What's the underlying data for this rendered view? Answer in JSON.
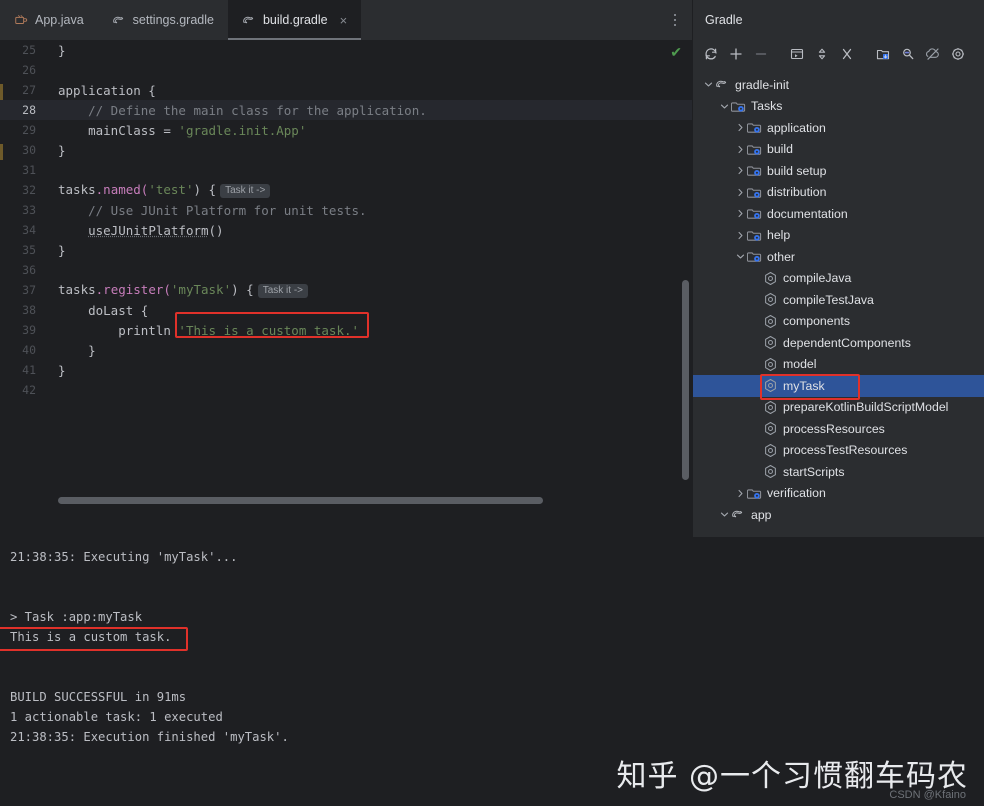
{
  "editor": {
    "tabs": [
      {
        "label": "App.java",
        "icon": "java-class-icon",
        "active": false,
        "closable": false
      },
      {
        "label": "settings.gradle",
        "icon": "gradle-elephant-icon",
        "active": false,
        "closable": false
      },
      {
        "label": "build.gradle",
        "icon": "gradle-elephant-icon",
        "active": true,
        "closable": true
      }
    ],
    "close_glyph": "×",
    "overflow_menu": "more-options",
    "inspection_status": "✔",
    "lines": [
      {
        "num": "25",
        "segments": [
          {
            "t": "}",
            "c": "plain"
          }
        ]
      },
      {
        "num": "26",
        "segments": []
      },
      {
        "num": "27",
        "segments": [
          {
            "t": "application {",
            "c": "plain"
          }
        ]
      },
      {
        "num": "28",
        "current": true,
        "segments": [
          {
            "t": "    // Define the main class for the application.",
            "c": "comment"
          }
        ]
      },
      {
        "num": "29",
        "segments": [
          {
            "t": "    mainClass = ",
            "c": "plain"
          },
          {
            "t": "'gradle.init.App'",
            "c": "string"
          }
        ]
      },
      {
        "num": "30",
        "segments": [
          {
            "t": "}",
            "c": "plain"
          }
        ]
      },
      {
        "num": "31",
        "segments": []
      },
      {
        "num": "32",
        "segments": [
          {
            "t": "tasks",
            "c": "plain"
          },
          {
            "t": ".named(",
            "c": "prop"
          },
          {
            "t": "'test'",
            "c": "string"
          },
          {
            "t": ") {",
            "c": "plain"
          },
          {
            "t": "Task it ->",
            "c": "inlay"
          }
        ]
      },
      {
        "num": "33",
        "segments": [
          {
            "t": "    // Use JUnit Platform for unit tests.",
            "c": "comment"
          }
        ]
      },
      {
        "num": "34",
        "segments": [
          {
            "t": "    ",
            "c": "plain"
          },
          {
            "t": "useJUnitPlatform",
            "c": "underline"
          },
          {
            "t": "()",
            "c": "plain"
          }
        ]
      },
      {
        "num": "35",
        "segments": [
          {
            "t": "}",
            "c": "plain"
          }
        ]
      },
      {
        "num": "36",
        "segments": []
      },
      {
        "num": "37",
        "segments": [
          {
            "t": "tasks",
            "c": "plain"
          },
          {
            "t": ".register(",
            "c": "prop"
          },
          {
            "t": "'myTask'",
            "c": "string"
          },
          {
            "t": ") {",
            "c": "plain"
          },
          {
            "t": "Task it ->",
            "c": "inlay"
          }
        ]
      },
      {
        "num": "38",
        "segments": [
          {
            "t": "    doLast {",
            "c": "plain"
          }
        ]
      },
      {
        "num": "39",
        "segments": [
          {
            "t": "        println ",
            "c": "plain"
          },
          {
            "t": "'This is a custom task.'",
            "c": "string"
          }
        ]
      },
      {
        "num": "40",
        "segments": [
          {
            "t": "    }",
            "c": "plain"
          }
        ]
      },
      {
        "num": "41",
        "segments": [
          {
            "t": "}",
            "c": "plain"
          }
        ]
      },
      {
        "num": "42",
        "segments": []
      }
    ]
  },
  "gradle": {
    "title": "Gradle",
    "toolbar": [
      {
        "name": "reload-all-gradle-projects-icon"
      },
      {
        "name": "link-gradle-project-icon"
      },
      {
        "name": "detach-gradle-project-icon"
      },
      {
        "name": "attach-gradle-project-icon"
      },
      {
        "name": "expand-collapse-icon"
      },
      {
        "name": "execute-task-icon"
      },
      {
        "name": "toggle-offline-mode-icon"
      },
      {
        "name": "show-dependencies-icon"
      },
      {
        "name": "skip-tests-icon"
      },
      {
        "name": "gradle-settings-icon"
      }
    ],
    "tree": [
      {
        "label": "gradle-init",
        "depth": 0,
        "twist": "expanded",
        "icon": "gradle-elephant-icon"
      },
      {
        "label": "Tasks",
        "depth": 1,
        "twist": "expanded",
        "icon": "task-folder-icon"
      },
      {
        "label": "application",
        "depth": 2,
        "twist": "collapsed",
        "icon": "task-folder-icon"
      },
      {
        "label": "build",
        "depth": 2,
        "twist": "collapsed",
        "icon": "task-folder-icon"
      },
      {
        "label": "build setup",
        "depth": 2,
        "twist": "collapsed",
        "icon": "task-folder-icon"
      },
      {
        "label": "distribution",
        "depth": 2,
        "twist": "collapsed",
        "icon": "task-folder-icon"
      },
      {
        "label": "documentation",
        "depth": 2,
        "twist": "collapsed",
        "icon": "task-folder-icon"
      },
      {
        "label": "help",
        "depth": 2,
        "twist": "collapsed",
        "icon": "task-folder-icon"
      },
      {
        "label": "other",
        "depth": 2,
        "twist": "expanded",
        "icon": "task-folder-icon"
      },
      {
        "label": "compileJava",
        "depth": 3,
        "twist": "none",
        "icon": "gradle-task-icon"
      },
      {
        "label": "compileTestJava",
        "depth": 3,
        "twist": "none",
        "icon": "gradle-task-icon"
      },
      {
        "label": "components",
        "depth": 3,
        "twist": "none",
        "icon": "gradle-task-icon"
      },
      {
        "label": "dependentComponents",
        "depth": 3,
        "twist": "none",
        "icon": "gradle-task-icon"
      },
      {
        "label": "model",
        "depth": 3,
        "twist": "none",
        "icon": "gradle-task-icon"
      },
      {
        "label": "myTask",
        "depth": 3,
        "twist": "none",
        "icon": "gradle-task-icon",
        "selected": true,
        "highlighted": true
      },
      {
        "label": "prepareKotlinBuildScriptModel",
        "depth": 3,
        "twist": "none",
        "icon": "gradle-task-icon"
      },
      {
        "label": "processResources",
        "depth": 3,
        "twist": "none",
        "icon": "gradle-task-icon"
      },
      {
        "label": "processTestResources",
        "depth": 3,
        "twist": "none",
        "icon": "gradle-task-icon"
      },
      {
        "label": "startScripts",
        "depth": 3,
        "twist": "none",
        "icon": "gradle-task-icon"
      },
      {
        "label": "verification",
        "depth": 2,
        "twist": "collapsed",
        "icon": "task-folder-icon"
      },
      {
        "label": "app",
        "depth": 1,
        "twist": "expanded",
        "icon": "gradle-elephant-icon"
      }
    ]
  },
  "console": {
    "lines": [
      "21:38:35: Executing 'myTask'...",
      "",
      "",
      "> Task :app:myTask",
      "This is a custom task.",
      "",
      "",
      "BUILD SUCCESSFUL in 91ms",
      "1 actionable task: 1 executed",
      "21:38:35: Execution finished 'myTask'."
    ],
    "highlighted_line_index": 4
  },
  "watermark": {
    "main": "知乎 @一个习惯翻车码农",
    "sub": "CSDN @Kfaino"
  },
  "colors": {
    "accent_selection": "#2e5499",
    "annotation_red": "#e0312a",
    "string_green": "#6a8759",
    "comment_gray": "#7a7e85",
    "panel_bg": "#2b2d30",
    "editor_bg": "#1e1f22"
  }
}
